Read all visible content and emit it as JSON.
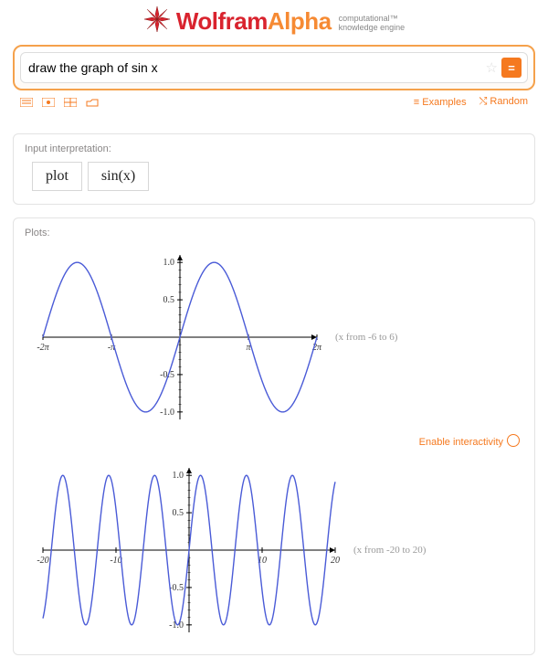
{
  "brand": {
    "wolfram": "Wolfram",
    "alpha": "Alpha",
    "tagline1": "computational",
    "tagline2": "knowledge engine",
    "tm": "™"
  },
  "search": {
    "value": "draw the graph of sin x",
    "go": "="
  },
  "toolbar": {
    "examples": "Examples",
    "random": "Random"
  },
  "panels": {
    "interpretation": {
      "title": "Input interpretation:",
      "items": [
        "plot",
        "sin(x)"
      ]
    },
    "plots": {
      "title": "Plots:"
    }
  },
  "interactivity": "Enable interactivity",
  "chart_data": [
    {
      "type": "line",
      "function": "sin(x)",
      "domain": [
        -6.283,
        6.283
      ],
      "xticks": [
        {
          "v": -6.283,
          "label": "-2π"
        },
        {
          "v": -3.1416,
          "label": "-π"
        },
        {
          "v": 3.1416,
          "label": "π"
        },
        {
          "v": 6.283,
          "label": "2π"
        }
      ],
      "yticks": [
        -1.0,
        -0.5,
        0.5,
        1.0
      ],
      "caption": "(x from -6 to 6)"
    },
    {
      "type": "line",
      "function": "sin(x)",
      "domain": [
        -20,
        20
      ],
      "xticks": [
        {
          "v": -20,
          "label": "-20"
        },
        {
          "v": -10,
          "label": "-10"
        },
        {
          "v": 10,
          "label": "10"
        },
        {
          "v": 20,
          "label": "20"
        }
      ],
      "yticks": [
        -1.0,
        -0.5,
        0.5,
        1.0
      ],
      "caption": "(x from -20 to 20)"
    }
  ]
}
